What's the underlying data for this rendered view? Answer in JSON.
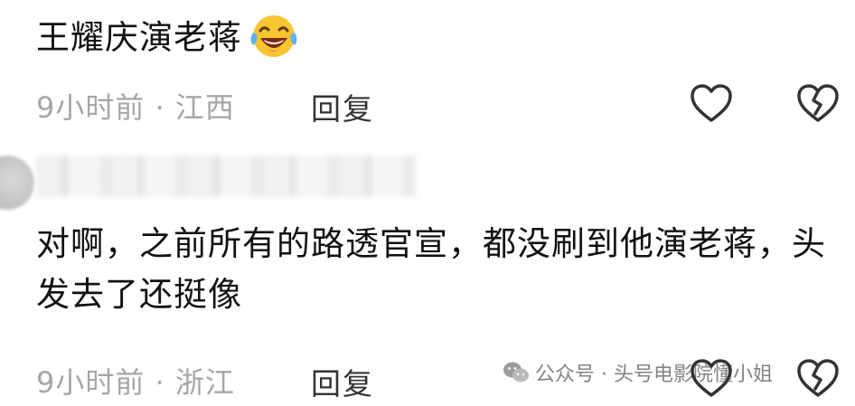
{
  "comments": [
    {
      "text": "王耀庆演老蒋",
      "emoji": "tears-of-joy-emoji",
      "time": "9小时前",
      "separator": "·",
      "location": "江西",
      "reply_label": "回复"
    },
    {
      "author": "",
      "text": "对啊，之前所有的路透官宣，都没刷到他演老蒋，头发去了还挺像",
      "time": "9小时前",
      "separator": "·",
      "location": "浙江",
      "reply_label": "回复"
    }
  ],
  "watermark": {
    "icon": "wechat-icon",
    "text": "公众号 · 头号电影院懂小姐"
  },
  "icons": {
    "like": "heart-outline-icon",
    "dislike": "broken-heart-icon"
  },
  "colors": {
    "text": "#111111",
    "meta": "#a6a6a6",
    "reply": "#333333",
    "icon_stroke": "#333333"
  }
}
